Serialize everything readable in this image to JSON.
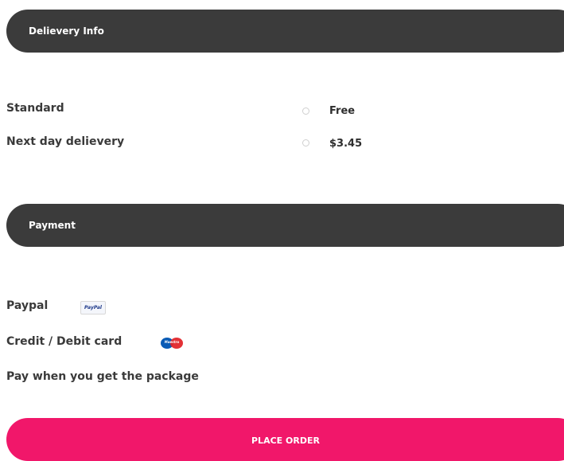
{
  "delivery": {
    "header": "Delievery Info",
    "options": [
      {
        "label": "Standard",
        "price": "Free"
      },
      {
        "label": "Next day delievery",
        "price": "$3.45"
      }
    ]
  },
  "payment": {
    "header": "Payment",
    "methods": [
      {
        "label": "Paypal",
        "badge_text": "PayPal",
        "icon": "paypal-icon"
      },
      {
        "label": "Credit / Debit card",
        "badge_text": "Maestro",
        "icon": "maestro-card-icon"
      },
      {
        "label": "Pay when you get the package"
      }
    ]
  },
  "actions": {
    "place_order": "PLACE ORDER"
  },
  "colors": {
    "section_bar": "#3b3b3b",
    "primary_button": "#f1176a",
    "text": "#3a3a3a"
  }
}
